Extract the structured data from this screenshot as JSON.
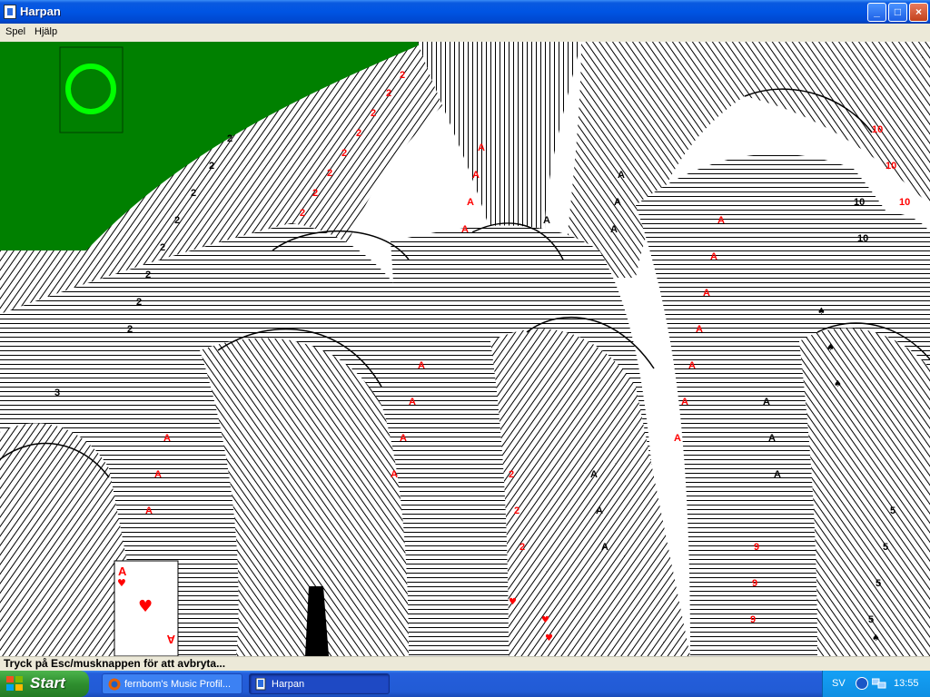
{
  "window": {
    "title": "Harpan",
    "buttons": {
      "minimize": "_",
      "maximize": "□",
      "close": "×"
    }
  },
  "menu": [
    "Spel",
    "Hjälp"
  ],
  "game": {
    "felt_color": "#008000",
    "deck_placeholder_color": "#00ff00",
    "card_red": "#ff0000",
    "card_black": "#000000",
    "featured_card": {
      "rank": "A",
      "suit": "♥"
    }
  },
  "status_text": "Tryck på Esc/musknappen för att avbryta...",
  "taskbar": {
    "start": "Start",
    "tasks": [
      {
        "label": "fernbom's Music Profil...",
        "icon": "firefox-icon",
        "active": false
      },
      {
        "label": "Harpan",
        "icon": "harpan-icon",
        "active": true
      }
    ],
    "tray": {
      "language": "SV",
      "clock": "13:55"
    }
  }
}
